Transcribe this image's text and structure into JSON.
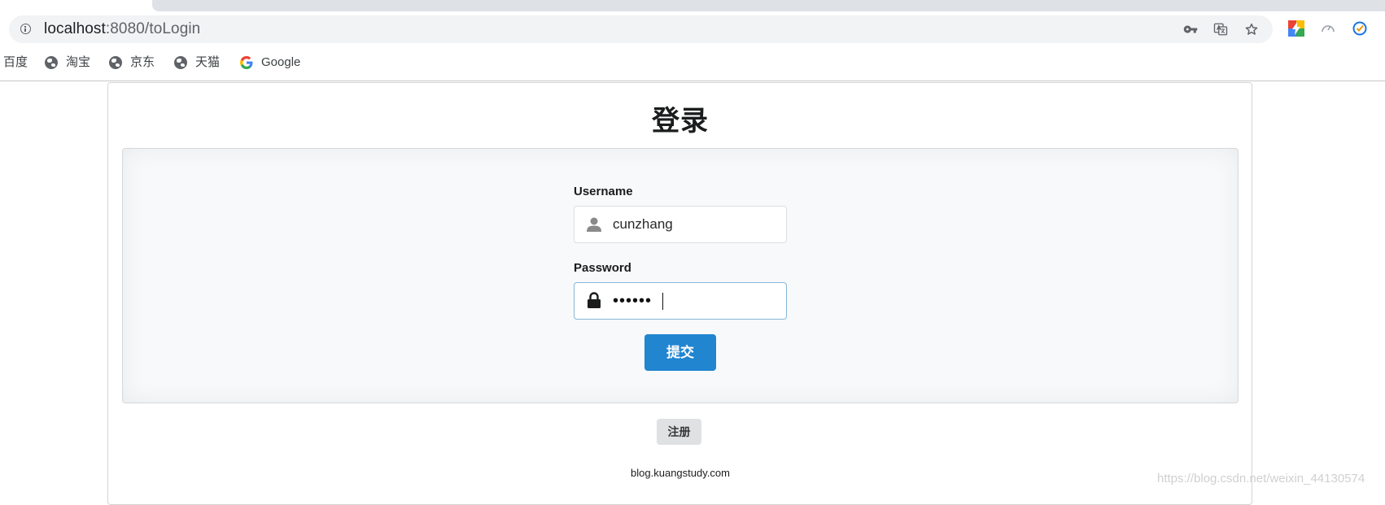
{
  "browser": {
    "url_host": "localhost",
    "url_rest": ":8080/toLogin",
    "bookmarks": [
      {
        "label": "百度"
      },
      {
        "label": "淘宝"
      },
      {
        "label": "京东"
      },
      {
        "label": "天猫"
      },
      {
        "label": "Google"
      }
    ]
  },
  "page": {
    "title": "登录",
    "username_label": "Username",
    "username_value": "cunzhang",
    "password_label": "Password",
    "password_value": "••••••",
    "submit_label": "提交",
    "register_label": "注册",
    "footer": "blog.kuangstudy.com"
  },
  "watermark": "https://blog.csdn.net/weixin_44130574",
  "colors": {
    "primary_button": "#2185d0",
    "secondary_button": "#e0e1e2",
    "focus_border": "#85b7d9"
  }
}
